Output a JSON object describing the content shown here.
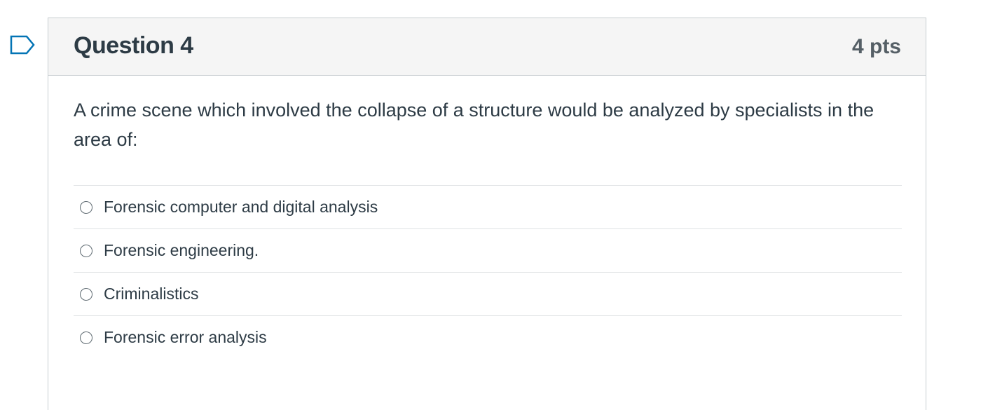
{
  "question": {
    "title": "Question 4",
    "points": "4 pts",
    "text": "A crime scene which involved the collapse of a structure would be analyzed by specialists in the area of:",
    "flag_icon": "flag-bookmark-icon",
    "answers": [
      {
        "label": "Forensic computer and digital analysis",
        "selected": false
      },
      {
        "label": "Forensic engineering.",
        "selected": false
      },
      {
        "label": "Criminalistics",
        "selected": false
      },
      {
        "label": "Forensic error analysis",
        "selected": false
      }
    ]
  },
  "colors": {
    "text": "#2d3b45",
    "header_bg": "#f5f5f5",
    "border": "#c7cdd1",
    "flag": "#0374b5"
  }
}
